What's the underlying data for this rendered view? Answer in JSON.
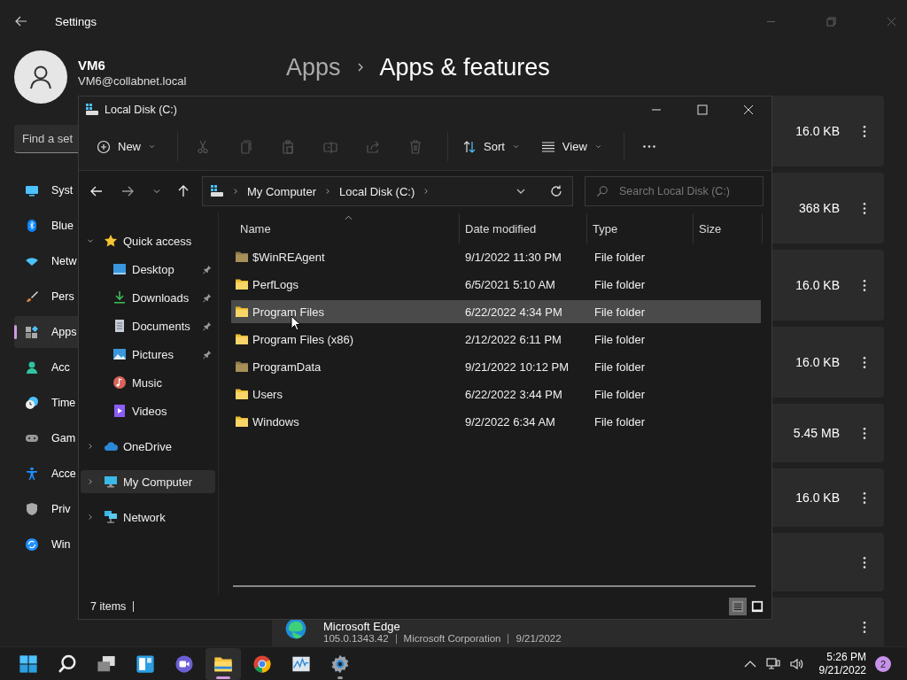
{
  "settings": {
    "title": "Settings",
    "user": {
      "name": "VM6",
      "email": "VM6@collabnet.local"
    },
    "search": {
      "placeholder": "Find a set"
    },
    "nav": [
      {
        "kind": "system",
        "label": "Syst",
        "selected": false
      },
      {
        "kind": "bluetooth",
        "label": "Blue",
        "selected": false
      },
      {
        "kind": "network",
        "label": "Netw",
        "selected": false
      },
      {
        "kind": "personalization",
        "label": "Pers",
        "selected": false
      },
      {
        "kind": "apps",
        "label": "Apps",
        "selected": true
      },
      {
        "kind": "accounts",
        "label": "Acc",
        "selected": false
      },
      {
        "kind": "time",
        "label": "Time",
        "selected": false
      },
      {
        "kind": "gaming",
        "label": "Gam",
        "selected": false
      },
      {
        "kind": "accessibility",
        "label": "Acce",
        "selected": false
      },
      {
        "kind": "privacy",
        "label": "Priv",
        "selected": false
      },
      {
        "kind": "update",
        "label": "Win",
        "selected": false
      }
    ],
    "breadcrumb": [
      "Apps",
      "Apps & features"
    ],
    "apps": [
      {
        "kind": "sized",
        "size": "16.0 KB"
      },
      {
        "kind": "sized",
        "size": "368 KB"
      },
      {
        "kind": "sized",
        "size": "16.0 KB"
      },
      {
        "kind": "sized",
        "size": "16.0 KB"
      },
      {
        "kind": "sized",
        "size": "5.45 MB"
      },
      {
        "kind": "sized",
        "size": "16.0 KB"
      },
      {
        "kind": "plain"
      },
      {
        "kind": "listing",
        "name": "Microsoft Edge",
        "version": "105.0.1343.42",
        "publisher": "Microsoft Corporation",
        "date": "9/21/2022"
      }
    ]
  },
  "explorer": {
    "title": "Local Disk (C:)",
    "toolbar": [
      {
        "kind": "new",
        "label": "New",
        "disabled": false
      },
      {
        "kind": "cut",
        "disabled": true
      },
      {
        "kind": "copy",
        "disabled": true
      },
      {
        "kind": "paste",
        "disabled": true
      },
      {
        "kind": "rename",
        "disabled": true
      },
      {
        "kind": "share",
        "disabled": true
      },
      {
        "kind": "delete",
        "disabled": true
      },
      {
        "kind": "sort",
        "label": "Sort",
        "disabled": false
      },
      {
        "kind": "view",
        "label": "View",
        "disabled": false
      },
      {
        "kind": "more",
        "disabled": false
      }
    ],
    "address": [
      "My Computer",
      "Local Disk (C:)"
    ],
    "search": {
      "placeholder": "Search Local Disk (C:)"
    },
    "nav": [
      {
        "kind": "quick",
        "label": "Quick access",
        "expanded": true,
        "selected": false,
        "children": [
          {
            "kind": "desktop",
            "label": "Desktop",
            "pinned": true,
            "selected": false
          },
          {
            "kind": "downloads",
            "label": "Downloads",
            "pinned": true,
            "selected": false
          },
          {
            "kind": "documents",
            "label": "Documents",
            "pinned": true,
            "selected": false
          },
          {
            "kind": "pictures",
            "label": "Pictures",
            "pinned": true,
            "selected": false
          },
          {
            "kind": "music",
            "label": "Music",
            "pinned": false,
            "selected": false
          },
          {
            "kind": "videos",
            "label": "Videos",
            "pinned": false,
            "selected": false
          }
        ]
      },
      {
        "kind": "onedrive",
        "label": "OneDrive",
        "expanded": false,
        "selected": false
      },
      {
        "kind": "computer",
        "label": "My Computer",
        "expanded": false,
        "selected": true
      },
      {
        "kind": "network",
        "label": "Network",
        "expanded": false,
        "selected": false
      }
    ],
    "columns": [
      {
        "label": "Name",
        "sorted": true
      },
      {
        "label": "Date modified",
        "sorted": false
      },
      {
        "label": "Type",
        "sorted": false
      },
      {
        "label": "Size",
        "sorted": false
      }
    ],
    "files": [
      {
        "name": "$WinREAgent",
        "date": "9/1/2022 11:30 PM",
        "type": "File folder",
        "hidden": true,
        "selected": false
      },
      {
        "name": "PerfLogs",
        "date": "6/5/2021 5:10 AM",
        "type": "File folder",
        "hidden": false,
        "selected": false
      },
      {
        "name": "Program Files",
        "date": "6/22/2022 4:34 PM",
        "type": "File folder",
        "hidden": false,
        "selected": true
      },
      {
        "name": "Program Files (x86)",
        "date": "2/12/2022 6:11 PM",
        "type": "File folder",
        "hidden": false,
        "selected": false
      },
      {
        "name": "ProgramData",
        "date": "9/21/2022 10:12 PM",
        "type": "File folder",
        "hidden": true,
        "selected": false
      },
      {
        "name": "Users",
        "date": "6/22/2022 3:44 PM",
        "type": "File folder",
        "hidden": false,
        "selected": false
      },
      {
        "name": "Windows",
        "date": "9/2/2022 6:34 AM",
        "type": "File folder",
        "hidden": false,
        "selected": false
      }
    ],
    "status": "7 items",
    "views": [
      {
        "kind": "details",
        "selected": true
      },
      {
        "kind": "tiles",
        "selected": false
      }
    ]
  },
  "taskbar": {
    "apps": [
      {
        "kind": "start",
        "active": false,
        "running": false
      },
      {
        "kind": "search",
        "active": false,
        "running": false
      },
      {
        "kind": "taskview",
        "active": false,
        "running": false
      },
      {
        "kind": "widgets",
        "active": false,
        "running": false
      },
      {
        "kind": "chat",
        "active": false,
        "running": false
      },
      {
        "kind": "explorer",
        "active": true,
        "running": true
      },
      {
        "kind": "chrome",
        "active": false,
        "running": false
      },
      {
        "kind": "monitor",
        "active": false,
        "running": false
      },
      {
        "kind": "settings",
        "active": false,
        "running": true
      }
    ],
    "time": "5:26 PM",
    "date": "9/21/2022",
    "notifications": "2"
  }
}
